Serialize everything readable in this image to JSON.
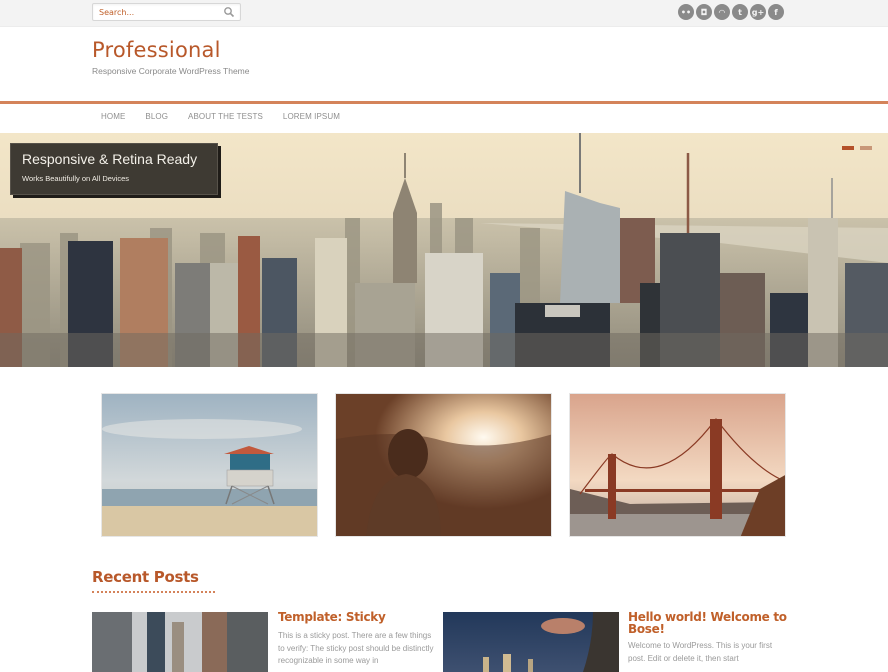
{
  "topbar": {
    "search_placeholder": "Search...",
    "social": [
      {
        "name": "flickr-icon",
        "glyph": "••"
      },
      {
        "name": "instagram-icon",
        "glyph": "◘"
      },
      {
        "name": "rss-icon",
        "glyph": "◠"
      },
      {
        "name": "twitter-icon",
        "glyph": "t"
      },
      {
        "name": "google-plus-icon",
        "glyph": "g+"
      },
      {
        "name": "facebook-icon",
        "glyph": "f"
      }
    ]
  },
  "header": {
    "site_title": "Professional",
    "tagline": "Responsive Corporate WordPress Theme"
  },
  "nav": {
    "items": [
      "HOME",
      "BLOG",
      "ABOUT THE TESTS",
      "LOREM IPSUM"
    ]
  },
  "slider": {
    "heading": "Responsive & Retina Ready",
    "subheading": "Works Beautifully on All Devices",
    "slide_count": 2,
    "active_slide": 1,
    "accent": "#b4512a"
  },
  "features": [
    {
      "name": "beach-lifeguard-tower-image"
    },
    {
      "name": "sunset-silhouette-image"
    },
    {
      "name": "golden-gate-bridge-image"
    }
  ],
  "recent_posts": {
    "heading": "Recent Posts",
    "posts": [
      {
        "title": "Template: Sticky",
        "excerpt": "This is a sticky post. There are a few things to verify: The sticky post should be distinctly recognizable in some way in"
      },
      {
        "title": "Hello world! Welcome to Bose!",
        "excerpt": "Welcome to WordPress. This is your first post. Edit or delete it, then start"
      }
    ]
  },
  "colors": {
    "brand": "#b8582a",
    "rule": "#d4835a",
    "nav_text": "#8f8f8f"
  }
}
